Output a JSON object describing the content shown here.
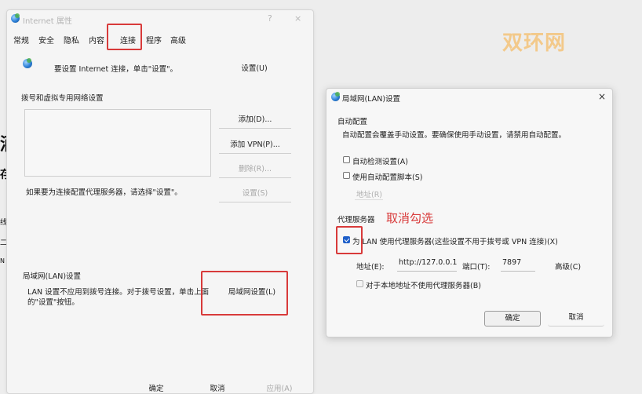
{
  "watermark": "双环网",
  "internet_properties": {
    "title": "Internet 属性",
    "help_glyph": "?",
    "close_glyph": "×",
    "tabs": [
      "常规",
      "安全",
      "隐私",
      "内容",
      "连接",
      "程序",
      "高级"
    ],
    "active_tab": "连接",
    "setup_text": "要设置 Internet 连接，单击\"设置\"。",
    "setup_button": "设置(U)",
    "dialup_heading": "拨号和虚拟专用网络设置",
    "add_button": "添加(D)...",
    "add_vpn_button": "添加 VPN(P)...",
    "remove_button": "删除(R)...",
    "proxy_hint": "如果要为连接配置代理服务器，请选择\"设置\"。",
    "settings_button": "设置(S)",
    "lan_heading": "局域网(LAN)设置",
    "lan_desc_line1": "LAN 设置不应用到拨号连接。对于拨号设置，单击上面",
    "lan_desc_line2": "的\"设置\"按钮。",
    "lan_settings_button": "局域网设置(L)",
    "ok_button": "确定",
    "cancel_button": "取消",
    "apply_button": "应用(A)"
  },
  "lan_dialog": {
    "title": "局域网(LAN)设置",
    "close_glyph": "×",
    "auto_heading": "自动配置",
    "auto_desc": "自动配置会覆盖手动设置。要确保使用手动设置，请禁用自动配置。",
    "auto_detect_label": "自动检测设置(A)",
    "auto_detect_checked": false,
    "auto_script_label": "使用自动配置脚本(S)",
    "auto_script_checked": false,
    "address_button": "地址(R)",
    "proxy_heading": "代理服务器",
    "use_proxy_label": "为 LAN 使用代理服务器(这些设置不用于拨号或 VPN 连接)(X)",
    "use_proxy_checked": true,
    "address_label": "地址(E):",
    "address_value": "http://127.0.0.1",
    "port_label": "端口(T):",
    "port_value": "7897",
    "advanced_button": "高级(C)",
    "bypass_label": "对于本地地址不使用代理服务器(B)",
    "bypass_checked": false,
    "ok_button": "确定",
    "cancel_button": "取消"
  },
  "annotation": "取消勾选",
  "edge_fragments": [
    "酒",
    "存",
    "线",
    "二",
    "N"
  ]
}
